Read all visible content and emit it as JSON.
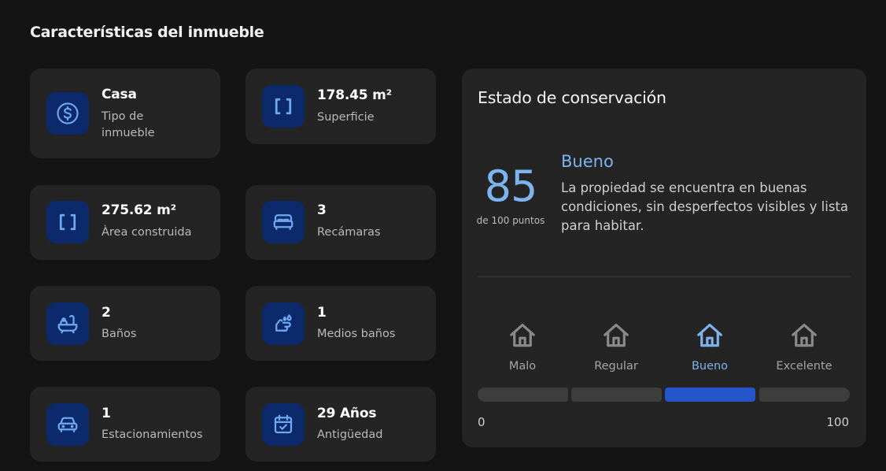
{
  "section_title": "Características del inmueble",
  "colors": {
    "background": "#141414",
    "card": "#242424",
    "icon_box": "#0c2a6b",
    "icon": "#6ea8ee",
    "accent": "#7db4ee",
    "active_bar": "#2456c9",
    "inactive_bar": "#3d3d3d"
  },
  "features": [
    {
      "icon": "dollar-circle-icon",
      "value": "Casa",
      "label": "Tipo de inmueble"
    },
    {
      "icon": "brackets-icon",
      "value": "178.45 m²",
      "label": "Superficie"
    },
    {
      "icon": "brackets-icon",
      "value": "275.62 m²",
      "label": "Àrea construida"
    },
    {
      "icon": "bed-icon",
      "value": "3",
      "label": "Recámaras"
    },
    {
      "icon": "bathtub-icon",
      "value": "2",
      "label": "Baños"
    },
    {
      "icon": "hand-wash-icon",
      "value": "1",
      "label": "Medios baños"
    },
    {
      "icon": "car-icon",
      "value": "1",
      "label": "Estacionamientos"
    },
    {
      "icon": "calendar-check-icon",
      "value": "29 Años",
      "label": "Antigüedad"
    }
  ],
  "conservation": {
    "title": "Estado de conservación",
    "score": "85",
    "score_caption": "de 100 puntos",
    "grade": "Bueno",
    "description": "La propiedad se encuentra en buenas condiciones, sin desperfectos visibles y lista para habitar.",
    "levels": [
      {
        "icon": "house-icon",
        "label": "Malo",
        "active": false
      },
      {
        "icon": "house-icon",
        "label": "Regular",
        "active": false
      },
      {
        "icon": "house-icon",
        "label": "Bueno",
        "active": true
      },
      {
        "icon": "house-icon",
        "label": "Excelente",
        "active": false
      }
    ],
    "scale_min": "0",
    "scale_max": "100"
  }
}
